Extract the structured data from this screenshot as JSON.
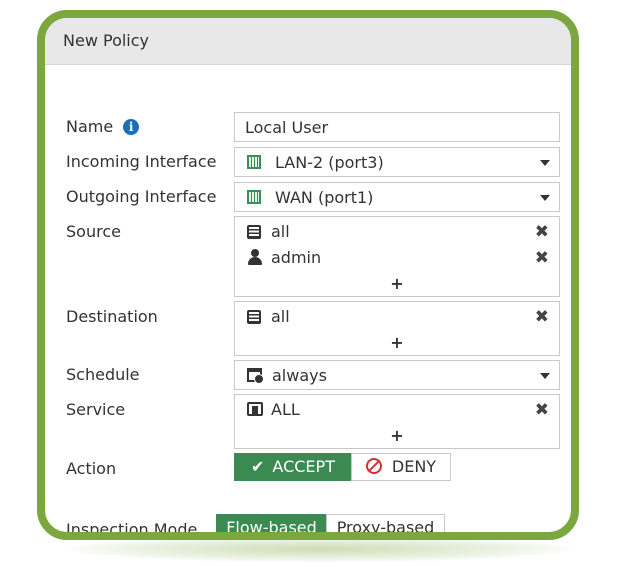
{
  "window": {
    "title": "New Policy"
  },
  "form": {
    "name": {
      "label": "Name",
      "value": "Local User",
      "info_icon": "info-icon"
    },
    "incoming": {
      "label": "Incoming Interface",
      "value": "LAN-2 (port3)",
      "icon": "port-icon"
    },
    "outgoing": {
      "label": "Outgoing Interface",
      "value": "WAN (port1)",
      "icon": "port-icon"
    },
    "source": {
      "label": "Source",
      "entries": [
        {
          "value": "all",
          "icon": "address-icon"
        },
        {
          "value": "admin",
          "icon": "user-icon"
        }
      ],
      "add": "+",
      "remove": "✖"
    },
    "destination": {
      "label": "Destination",
      "entries": [
        {
          "value": "all",
          "icon": "address-icon"
        }
      ],
      "add": "+",
      "remove": "✖"
    },
    "schedule": {
      "label": "Schedule",
      "value": "always",
      "icon": "schedule-icon"
    },
    "service": {
      "label": "Service",
      "entries": [
        {
          "value": "ALL",
          "icon": "service-icon"
        }
      ],
      "add": "+",
      "remove": "✖"
    },
    "action": {
      "label": "Action",
      "accept": "ACCEPT",
      "deny": "DENY",
      "selected": "ACCEPT"
    },
    "inspection": {
      "label": "Inspection Mode",
      "flow": "Flow-based",
      "proxy": "Proxy-based",
      "selected": "Flow-based"
    }
  },
  "colors": {
    "frame": "#7ca63e",
    "accent": "#3b8a52",
    "deny": "#d42e2e",
    "info": "#1a6fb9"
  }
}
